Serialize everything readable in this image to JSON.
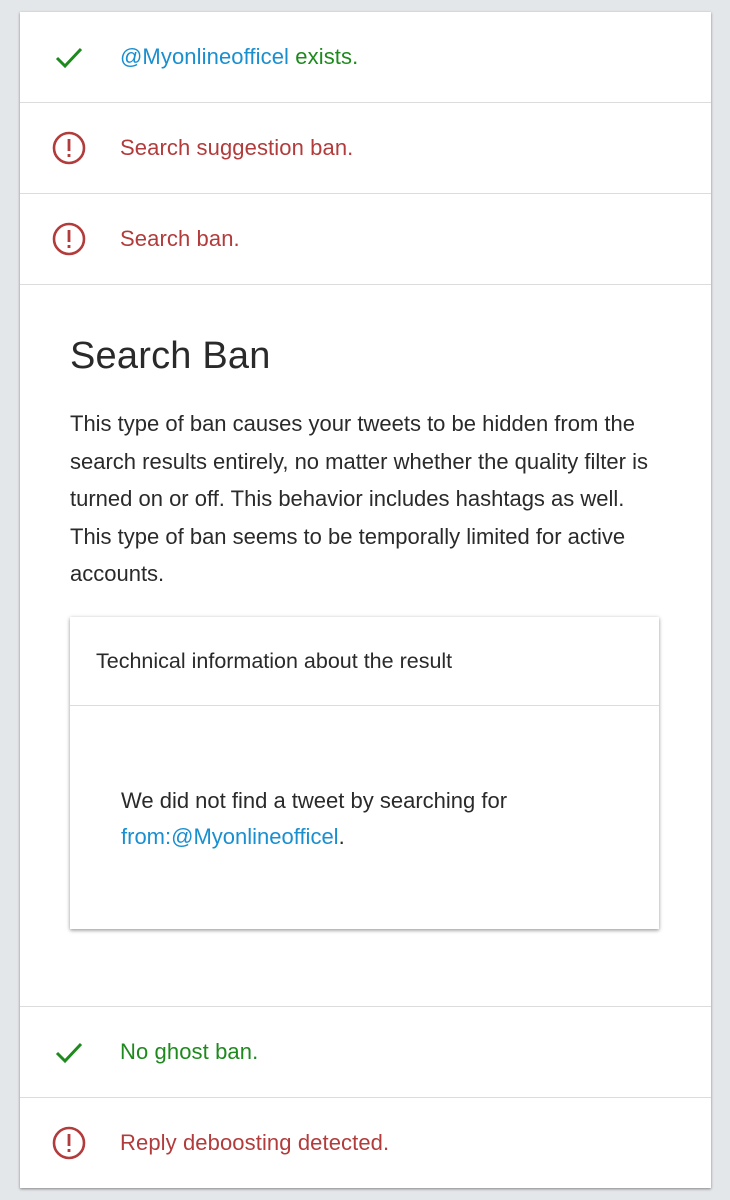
{
  "checks": [
    {
      "status": "ok",
      "icon": "check-icon",
      "handle": "@Myonlineofficel",
      "label": " exists."
    },
    {
      "status": "fail",
      "icon": "alert-circle-icon",
      "label": "Search suggestion ban."
    },
    {
      "status": "fail",
      "icon": "alert-circle-icon",
      "label": "Search ban."
    },
    {
      "status": "ok",
      "icon": "check-icon",
      "label": "No ghost ban."
    },
    {
      "status": "fail",
      "icon": "alert-circle-icon",
      "label": "Reply deboosting detected."
    }
  ],
  "detail": {
    "title": "Search Ban",
    "description": "This type of ban causes your tweets to be hidden from the search results entirely, no matter whether the quality filter is turned on or off. This behavior includes hashtags as well. This type of ban seems to be temporally limited for active accounts.",
    "technical": {
      "header": "Technical information about the result",
      "text_before": "We did not find a tweet by searching for ",
      "query": "from:@Myonlineofficel",
      "text_after": "."
    }
  },
  "colors": {
    "ok": "#1e8a1e",
    "fail": "#b23b3b",
    "link": "#1a8fd0"
  }
}
